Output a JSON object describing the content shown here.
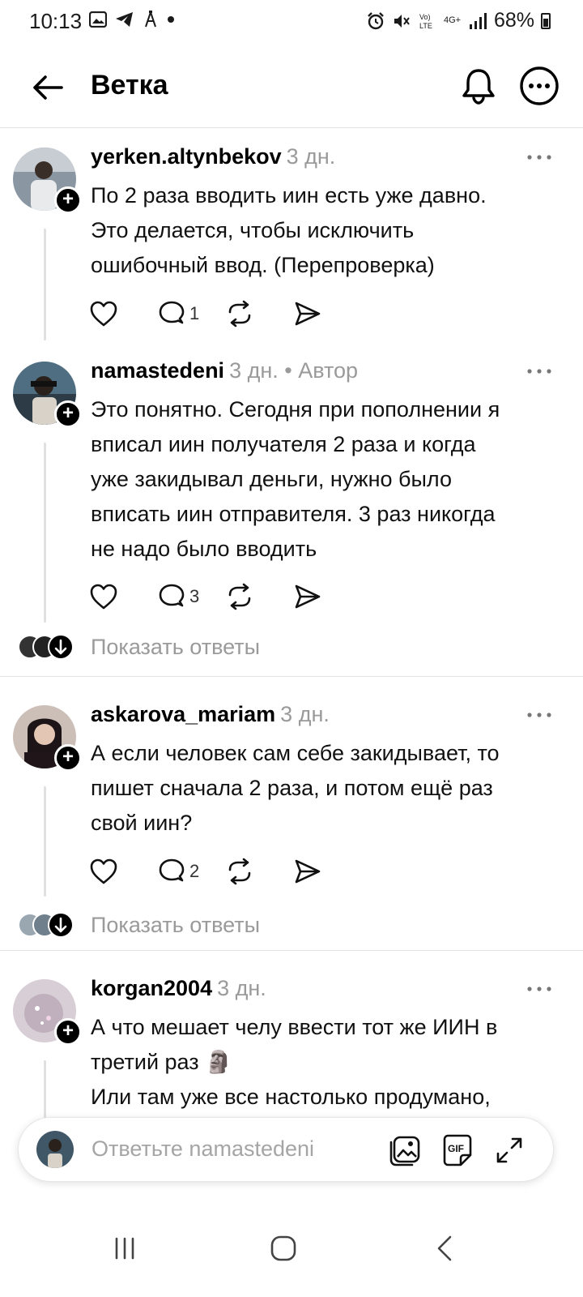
{
  "status_bar": {
    "time": "10:13",
    "battery": "68%",
    "network_label": "4G+"
  },
  "header": {
    "title": "Ветка"
  },
  "posts": [
    {
      "username": "yerken.altynbekov",
      "time": "3 дн.",
      "author_tag": "",
      "text": "По 2 раза вводить иин есть уже давно.\nЭто делается, чтобы исключить\nошибочный ввод. (Перепроверка)",
      "reply_count": "1",
      "avatar_color": "#7d8a96"
    },
    {
      "username": "namastedeni",
      "time": "3 дн.",
      "author_tag": " • Автор",
      "text": "Это понятно. Сегодня при пополнении я\nвписал иин получателя 2 раза и когда\nуже закидывал деньги, нужно было\nвписать иин отправителя. 3 раз никогда\nне надо было вводить",
      "reply_count": "3",
      "avatar_color": "#3f5766"
    },
    {
      "username": "askarova_mariam",
      "time": "3 дн.",
      "author_tag": "",
      "text": "А если человек сам себе закидывает, то\nпишет сначала 2 раза, и потом ещё раз\nсвой иин?",
      "reply_count": "2",
      "avatar_color": "#4a3b3f"
    },
    {
      "username": "korgan2004",
      "time": "3 дн.",
      "author_tag": "",
      "text": "А что мешает челу ввести тот же ИИН в\nтретий раз 🗿\nИли там уже все настолько продумано,",
      "reply_count": "",
      "avatar_color": "#c9b9c4"
    }
  ],
  "show_replies_label": "Показать ответы",
  "reply_bar": {
    "placeholder": "Ответьте namastedeni",
    "gif_label": "GIF"
  }
}
